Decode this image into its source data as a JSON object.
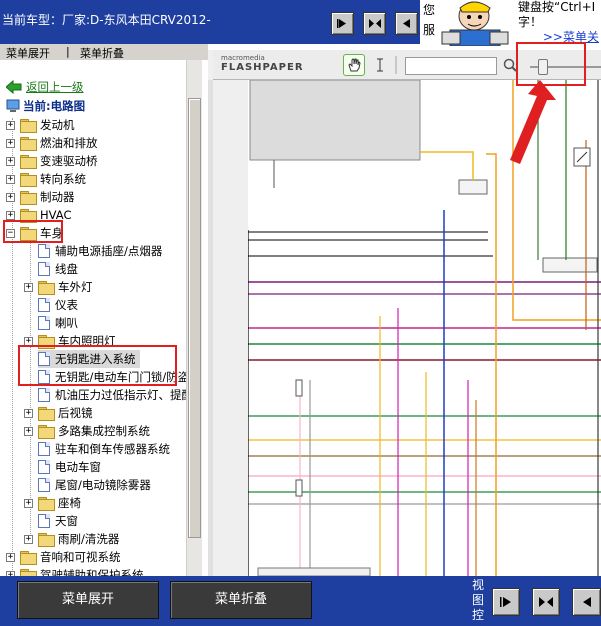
{
  "topbar": {
    "title": "当前车型：厂家:D-东风本田CRV2012-",
    "side_tab_text": "您服",
    "hint_text": "键盘按“Ctrl+I字！",
    "hint_link": ">>菜单关"
  },
  "menubar2": {
    "expand_label": "菜单展开",
    "collapse_label": "菜单折叠"
  },
  "tree": {
    "back_label": "返回上一级",
    "current_label": "当前:电路图",
    "items": [
      {
        "label": "发动机"
      },
      {
        "label": "燃油和排放"
      },
      {
        "label": "变速驱动桥"
      },
      {
        "label": "转向系统"
      },
      {
        "label": "制动器"
      },
      {
        "label": "HVAC"
      },
      {
        "label": "车身"
      },
      {
        "label": "辅助电源插座/点烟器"
      },
      {
        "label": "线盘"
      },
      {
        "label": "车外灯"
      },
      {
        "label": "仪表"
      },
      {
        "label": "喇叭"
      },
      {
        "label": "车内照明灯"
      },
      {
        "label": "无钥匙进入系统"
      },
      {
        "label": "无钥匙/电动车门门锁/防盗"
      },
      {
        "label": "机油压力过低指示灯、提醒"
      },
      {
        "label": "后视镜"
      },
      {
        "label": "多路集成控制系统"
      },
      {
        "label": "驻车和倒车传感器系统"
      },
      {
        "label": "电动车窗"
      },
      {
        "label": "尾窗/电动镜除雾器"
      },
      {
        "label": "座椅"
      },
      {
        "label": "天窗"
      },
      {
        "label": "雨刷/清洗器"
      },
      {
        "label": "音响和可视系统"
      },
      {
        "label": "驾驶辅助和保护系统"
      }
    ]
  },
  "flash": {
    "logo_small": "macromedia",
    "logo_big": "FLASHPAPER"
  },
  "bottom": {
    "expand_label": "菜单展开",
    "collapse_label": "菜单折叠",
    "view_label": "视图控"
  },
  "colors": {
    "topbar": "#1e3fa0",
    "highlight_box": "#e02020"
  }
}
